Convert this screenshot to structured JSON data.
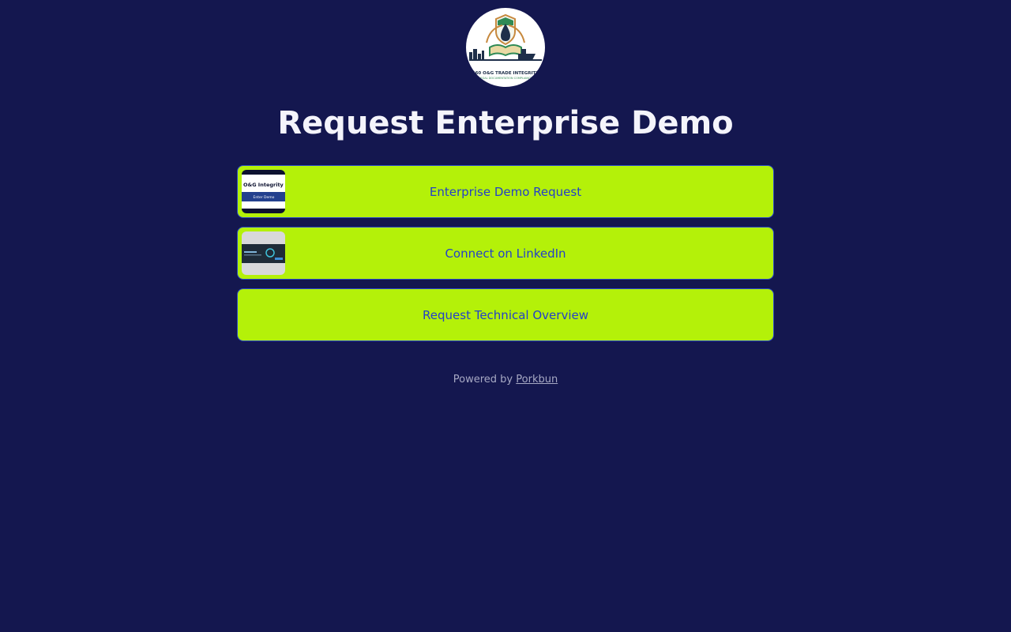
{
  "profile": {
    "logo_icon": "oil-drop-shield-book-logo",
    "logo_text": "360 O&G TRADE INTEGRITY",
    "logo_subtext": "LEGAL DOCUMENTATION COMPLIANCE"
  },
  "page": {
    "title": "Request Enterprise Demo"
  },
  "links": [
    {
      "label": "Enterprise Demo Request",
      "thumbnail": {
        "icon": "og-integrity-banner-thumbnail",
        "heading": "O&G Integrity",
        "button": "Enter Demo"
      }
    },
    {
      "label": "Connect on LinkedIn",
      "thumbnail": {
        "icon": "linkedin-banner-thumbnail"
      }
    },
    {
      "label": "Request Technical Overview"
    }
  ],
  "footer": {
    "prefix": "Powered by",
    "link_text": "Porkbun"
  },
  "colors": {
    "background": "#14174f",
    "button_fill": "#b4f109",
    "button_border": "#2a48c9",
    "button_text": "#2440c8",
    "title_text": "#f4f4fb",
    "footer_text": "#a7a9c4"
  }
}
